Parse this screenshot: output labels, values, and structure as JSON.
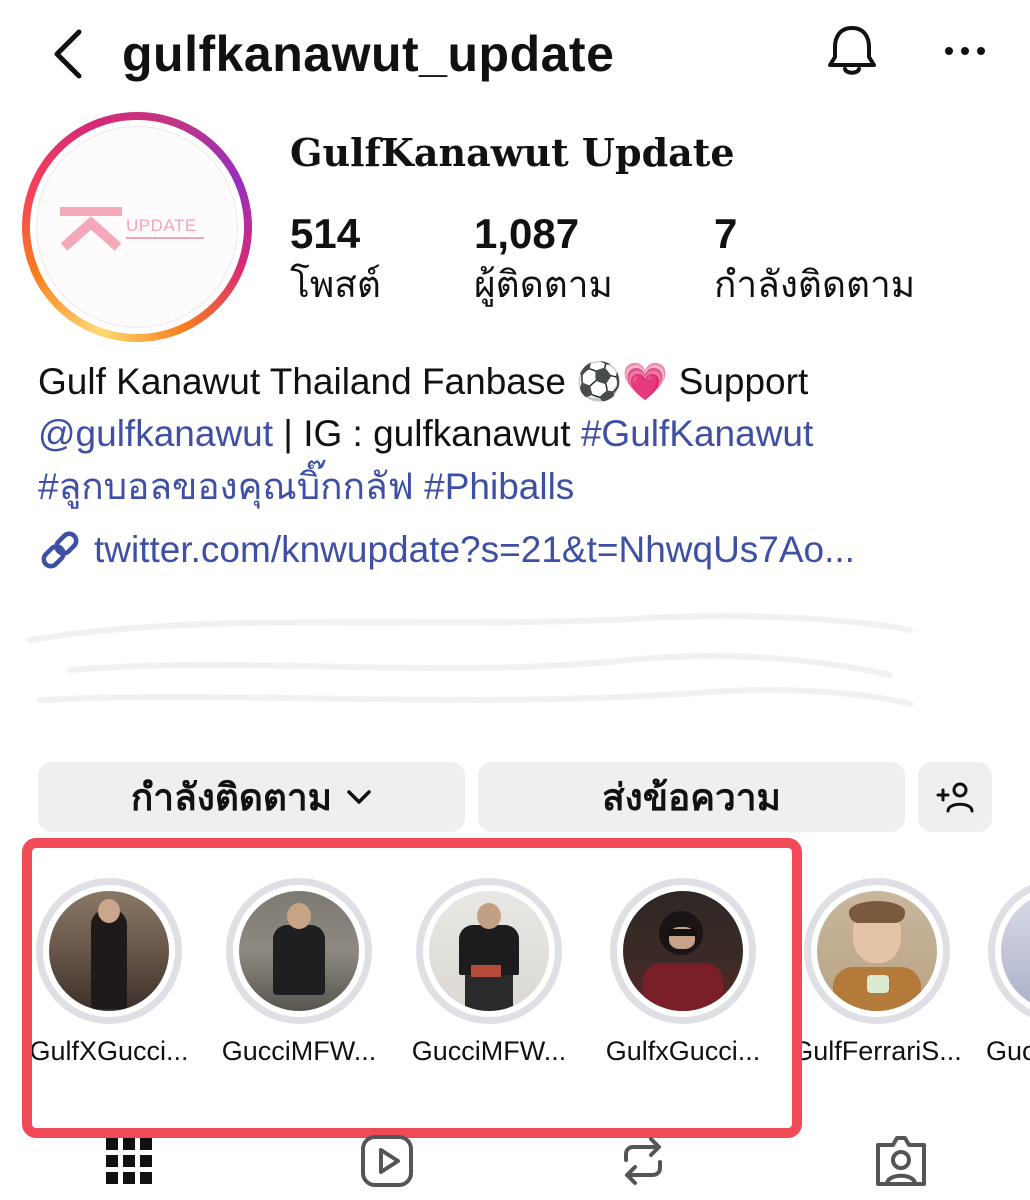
{
  "header": {
    "username": "gulfkanawut_update",
    "back_icon": "chevron-left-icon",
    "bell_icon": "bell-icon",
    "more_icon": "more-horizontal-icon"
  },
  "profile": {
    "avatar_logo_text": "UPDATE",
    "display_name": "GulfKanawut Update",
    "stats": [
      {
        "value": "514",
        "label": "โพสต์"
      },
      {
        "value": "1,087",
        "label": "ผู้ติดตาม"
      },
      {
        "value": "7",
        "label": "กำลังติดตาม"
      }
    ]
  },
  "bio": {
    "line1": "Gulf Kanawut Thailand Fanbase ⚽️💗 Support",
    "line2_mention": "@gulfkanawut",
    "line2_text": " | IG : gulfkanawut ",
    "line2_hashtag": "#GulfKanawut",
    "line3_hashtag1": "#ลูกบอลของคุณบิ๊กกลัฟ",
    "line3_hashtag2": "#Phiballs",
    "link": "twitter.com/knwupdate?s=21&t=NhwqUs7Ao..."
  },
  "actions": {
    "follow_label": "กำลังติดตาม",
    "message_label": "ส่งข้อความ",
    "add_person_icon": "add-person-icon"
  },
  "highlights": [
    {
      "label": "GulfXGucci..."
    },
    {
      "label": "GucciMFW..."
    },
    {
      "label": "GucciMFW..."
    },
    {
      "label": "GulfxGucci..."
    },
    {
      "label": "GulfFerrariS..."
    },
    {
      "label": "Guc"
    }
  ],
  "colors": {
    "link_blue": "#3e4fa5",
    "highlight_frame": "#ef4a55"
  },
  "tabs": [
    {
      "icon": "grid-icon"
    },
    {
      "icon": "reels-icon"
    },
    {
      "icon": "reposts-icon"
    },
    {
      "icon": "tagged-icon"
    }
  ]
}
